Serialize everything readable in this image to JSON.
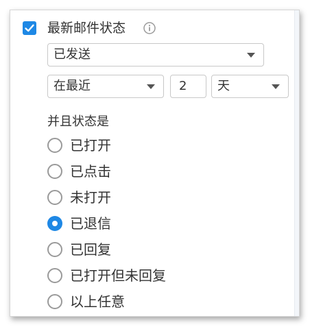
{
  "filter": {
    "checked": true,
    "title": "最新邮件状态",
    "info_icon": "info-icon",
    "status_select": {
      "value": "已发送"
    },
    "range_select": {
      "value": "在最近"
    },
    "count_input": {
      "value": "2"
    },
    "unit_select": {
      "value": "天"
    },
    "subheading": "并且状态是",
    "options": [
      {
        "label": "已打开",
        "selected": false
      },
      {
        "label": "已点击",
        "selected": false
      },
      {
        "label": "未打开",
        "selected": false
      },
      {
        "label": "已退信",
        "selected": true
      },
      {
        "label": "已回复",
        "selected": false
      },
      {
        "label": "已打开但未回复",
        "selected": false
      },
      {
        "label": "以上任意",
        "selected": false
      }
    ]
  },
  "colors": {
    "accent": "#1e88e5",
    "border": "#c8c8c8",
    "text": "#333333"
  }
}
